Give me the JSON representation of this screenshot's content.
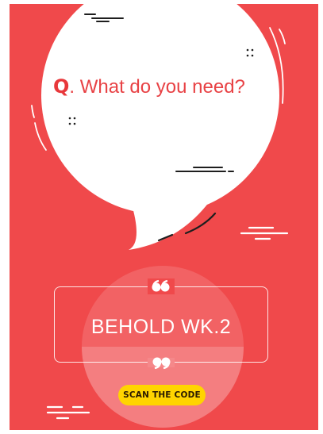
{
  "question": {
    "prefix": "Q",
    "text": ". What do you need?"
  },
  "title_box": {
    "title": "BEHOLD WK.2"
  },
  "cta": {
    "label": "SCAN THE CODE"
  },
  "icons": {
    "top_quote": "open-quote-icon",
    "bottom_quote": "close-quote-icon"
  },
  "colors": {
    "background": "#f0494b",
    "bubble": "#ffffff",
    "accent_yellow": "#ffd400",
    "text_red": "#e84245"
  }
}
